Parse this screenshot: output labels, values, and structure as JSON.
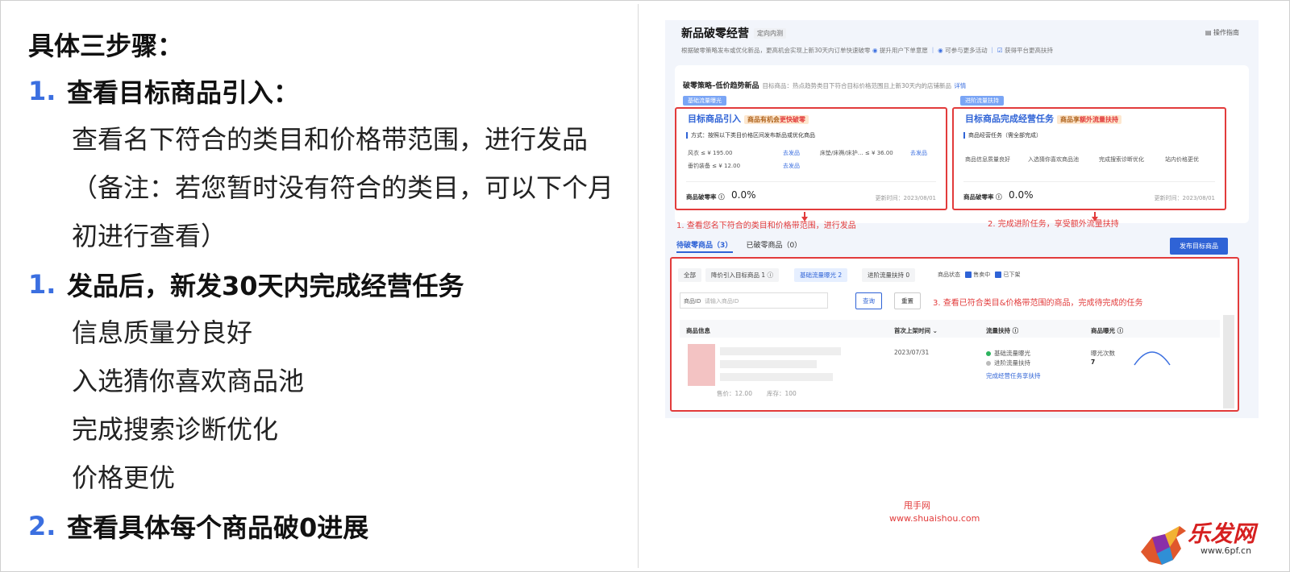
{
  "left": {
    "title": "具体三步骤：",
    "step1_num": "1.",
    "step1_title": "查看目标商品引入：",
    "step1_para": "查看名下符合的类目和价格带范围，进行发品（备注：若您暂时没有符合的类目，可以下个月初进行查看）",
    "step2_num": "1.",
    "step2_title": "发品后，新发30天内完成经营任务",
    "tasks": [
      "信息质量分良好",
      "入选猜你喜欢商品池",
      "完成搜索诊断优化",
      "价格更优"
    ],
    "step3_num": "2.",
    "step3_title": "查看具体每个商品破0进展"
  },
  "shot": {
    "title": "新品破零经营",
    "tag": "定向内测",
    "guide": "操作指南",
    "desc": "根据破零策略发布或优化新品，更高机会实现上新30天内订单快速破零",
    "desc_items": [
      "提升用户下单意愿",
      "可参与更多活动",
      "获得平台更高扶持"
    ],
    "strategy_title": "破零策略–低价趋势新品",
    "strategy_desc": "目标商品：热点趋势类目下符合目标价格范围且上新30天内的店铺新品",
    "strategy_link": "详情",
    "pill_left": "基础流量曝光",
    "pill_right": "进阶流量扶持",
    "box_left": {
      "title": "目标商品引入",
      "badge_a": "商品有机会",
      "badge_b": "更快破零",
      "method": "方式：按照以下类目价格区间发布新品或优化商品",
      "row1_a": "风衣 ≤ ¥ 195.00",
      "row1_link": "去发品",
      "row1_b": "床垫/床褥/床护…  ≤ ¥ 36.00",
      "row1_link2": "去发品",
      "row2_a": "垂钓装备 ≤ ¥ 12.00",
      "row2_link": "去发品",
      "rate_label": "商品破零率",
      "rate_value": "0.0%",
      "update": "更新时间：2023/08/01"
    },
    "box_right": {
      "title": "目标商品完成经营任务",
      "badge_a": "商品享",
      "badge_b": "额外流量扶持",
      "tasks_head": "商品经营任务（需全部完成）",
      "tasks": [
        "商品信息质量良好",
        "入选猜你喜欢商品池",
        "完成搜索诊断优化",
        "站内价格更优"
      ],
      "rate_label": "商品破零率",
      "rate_value": "0.0%",
      "update": "更新时间：2023/08/01"
    },
    "note1": "1. 查看您名下符合的类目和价格带范围，进行发品",
    "note2": "2. 完成进阶任务，享受额外流量扶持",
    "note3": "3. 查看已符合类目&价格带范围的商品，完成待完成的任务",
    "tab_pending": "待破零商品（3）",
    "tab_done": "已破零商品（0）",
    "publish_btn": "发布目标商品",
    "chips": [
      "全部",
      "降价引入目标商品 1 ⓘ",
      "基础流量曝光 2",
      "进阶流量扶持 0"
    ],
    "status_label": "商品状态",
    "status_on": "售卖中",
    "status_off": "已下架",
    "id_label": "商品ID",
    "id_placeholder": "请输入商品ID",
    "btn_query": "查询",
    "btn_reset": "重置",
    "th": [
      "商品信息",
      "首次上架时间 ⌄",
      "流量扶持 ⓘ",
      "商品曝光 ⓘ"
    ],
    "row": {
      "date": "2023/07/31",
      "flow1": "基础流量曝光",
      "flow2": "进阶流量扶持",
      "flow_link": "完成经营任务享扶持",
      "exp_label": "曝光次数",
      "exp_value": "7",
      "price": "售价：12.00",
      "stock": "库存：100"
    }
  },
  "watermark": {
    "line1": "甩手网",
    "line2": "www.shuaishou.com"
  },
  "logo": {
    "text": "乐发网",
    "url": "www.6pf.cn"
  }
}
